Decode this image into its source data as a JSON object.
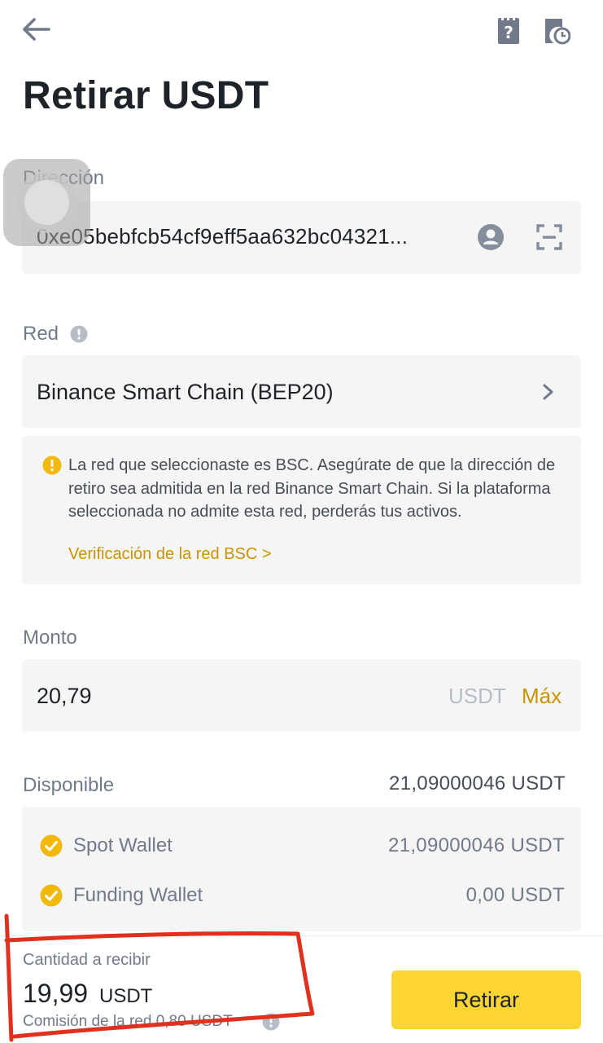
{
  "header": {
    "title": "Retirar USDT",
    "back_icon": "arrow-left-icon",
    "faq_icon": "faq-document-icon",
    "history_icon": "history-document-icon"
  },
  "address": {
    "label": "Dirección",
    "value": "0xe05bebfcb54cf9eff5aa632bc04321...",
    "address_book_icon": "address-book-icon",
    "scan_icon": "qr-scan-icon"
  },
  "network": {
    "label": "Red",
    "info_icon": "info-icon",
    "value": "Binance Smart Chain (BEP20)",
    "chevron_icon": "chevron-right-icon",
    "warning_text": "La red que seleccionaste es BSC. Asegúrate de que la dirección de retiro sea admitida en la red Binance Smart Chain. Si la plataforma seleccionada no admite esta red, perderás tus activos.",
    "warning_link": "Verificación de la red BSC >"
  },
  "amount": {
    "label": "Monto",
    "value": "20,79",
    "unit": "USDT",
    "max_label": "Máx"
  },
  "available": {
    "label": "Disponible",
    "value": "21,09000046 USDT",
    "wallets": [
      {
        "name": "Spot Wallet",
        "amount": "21,09000046 USDT"
      },
      {
        "name": "Funding Wallet",
        "amount": "0,00 USDT"
      }
    ]
  },
  "footer": {
    "receive_label": "Cantidad a recibir",
    "receive_amount": "19,99",
    "receive_unit": "USDT",
    "fee_text": "Comisión de la red 0,80 USDT",
    "withdraw_button": "Retirar"
  },
  "colors": {
    "accent": "#fcd535",
    "link": "#c99400",
    "annotation": "#e0301e"
  }
}
